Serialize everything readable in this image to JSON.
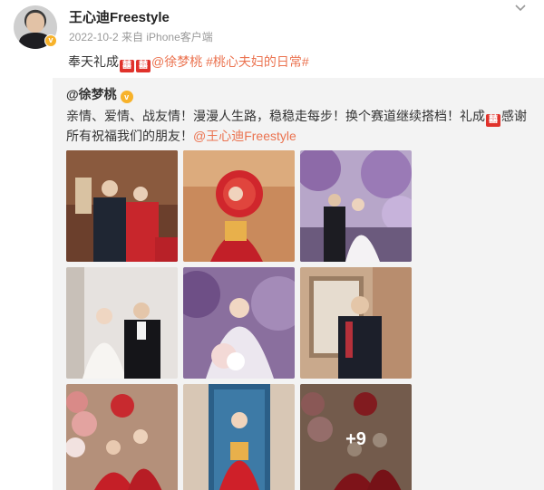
{
  "post": {
    "author": "王心迪Freestyle",
    "meta": "2022-10-2  来自 iPhone客户端",
    "text_prefix": "奉天礼成",
    "mention": "@徐梦桃",
    "hashtag": "#桃心夫妇的日常#",
    "emoji_xi": "囍"
  },
  "repost": {
    "author": "@徐梦桃",
    "text_main": "亲情、爱情、战友情！漫漫人生路，稳稳走每步！换个赛道继续搭档！礼成",
    "text_tail": "感谢所有祝福我们的朋友！",
    "mention": "@王心迪Freestyle",
    "more_count": "+9"
  },
  "icons": {
    "menu": "chevron-down-icon",
    "verify": "verified-badge-icon"
  },
  "colors": {
    "link": "#eb7350",
    "repost_bg": "#f3f3f3",
    "badge": "#f7b22a",
    "xi_red": "#e0322b"
  }
}
